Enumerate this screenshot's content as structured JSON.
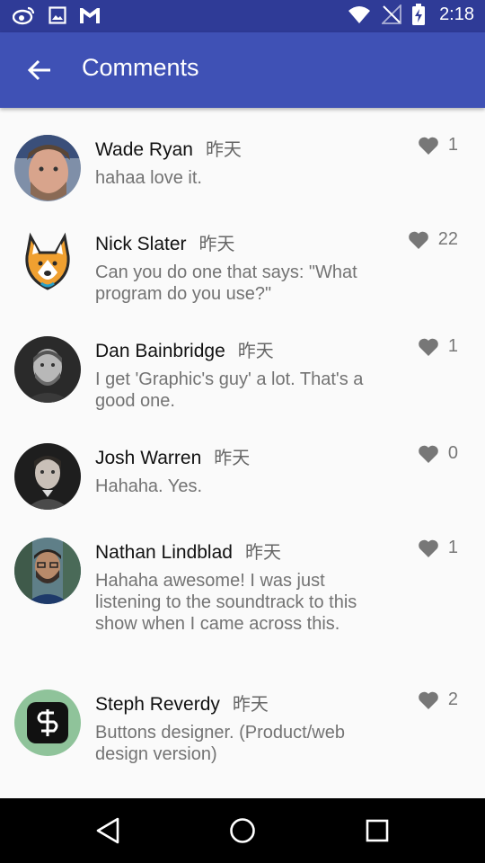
{
  "status_bar": {
    "time": "2:18",
    "icons": [
      "weibo-icon",
      "image-icon",
      "gmail-icon",
      "wifi-icon",
      "no-signal-icon",
      "battery-charging-icon"
    ]
  },
  "app_bar": {
    "title": "Comments",
    "back_icon": "arrow-back-icon",
    "background": "#3f51b5"
  },
  "comments": [
    {
      "author": "Wade Ryan",
      "time": "昨天",
      "text": "hahaa love it.",
      "likes": "1"
    },
    {
      "author": "Nick Slater",
      "time": "昨天",
      "text": "Can you do one that says: \"What program do you use?\"",
      "likes": "22"
    },
    {
      "author": "Dan Bainbridge",
      "time": "昨天",
      "text": "I get 'Graphic's guy' a lot. That's a good one.",
      "likes": "1"
    },
    {
      "author": "Josh Warren",
      "time": "昨天",
      "text": "Hahaha. Yes.",
      "likes": "0"
    },
    {
      "author": "Nathan Lindblad",
      "time": "昨天",
      "text": "Hahaha awesome! I was just listening to the soundtrack to this show when I came across this.",
      "likes": "1"
    },
    {
      "author": "Steph Reverdy",
      "time": "昨天",
      "text": "Buttons designer. (Product/web design version)",
      "likes": "2"
    }
  ],
  "nav_bar": {
    "icons": [
      "nav-back-icon",
      "nav-home-icon",
      "nav-recents-icon"
    ]
  }
}
